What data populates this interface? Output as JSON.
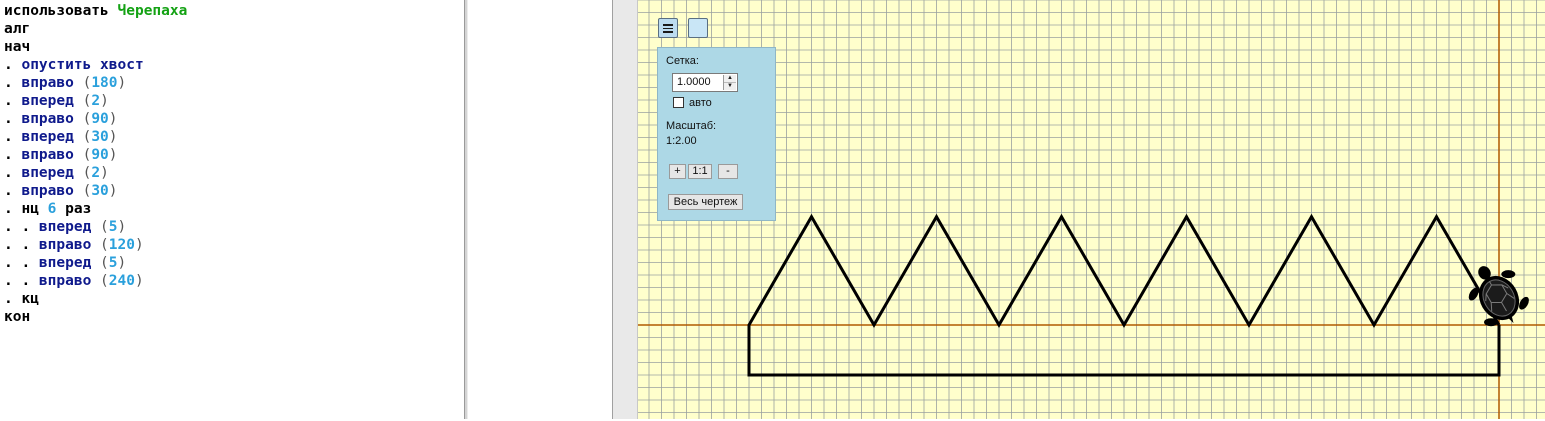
{
  "editor": {
    "lines": [
      [
        {
          "t": "использовать ",
          "c": "kw"
        },
        {
          "t": "Черепаха",
          "c": "actor"
        }
      ],
      [
        {
          "t": "алг",
          "c": "kw"
        }
      ],
      [
        {
          "t": "нач",
          "c": "kw"
        }
      ],
      [
        {
          "t": ". ",
          "c": "dot"
        },
        {
          "t": "опустить хвост",
          "c": "cmd"
        }
      ],
      [
        {
          "t": ". ",
          "c": "dot"
        },
        {
          "t": "вправо",
          "c": "cmd"
        },
        {
          "t": " (",
          "c": "paren"
        },
        {
          "t": "180",
          "c": "num"
        },
        {
          "t": ")",
          "c": "paren"
        }
      ],
      [
        {
          "t": ". ",
          "c": "dot"
        },
        {
          "t": "вперед",
          "c": "cmd"
        },
        {
          "t": " (",
          "c": "paren"
        },
        {
          "t": "2",
          "c": "num"
        },
        {
          "t": ")",
          "c": "paren"
        }
      ],
      [
        {
          "t": ". ",
          "c": "dot"
        },
        {
          "t": "вправо",
          "c": "cmd"
        },
        {
          "t": " (",
          "c": "paren"
        },
        {
          "t": "90",
          "c": "num"
        },
        {
          "t": ")",
          "c": "paren"
        }
      ],
      [
        {
          "t": ". ",
          "c": "dot"
        },
        {
          "t": "вперед",
          "c": "cmd"
        },
        {
          "t": " (",
          "c": "paren"
        },
        {
          "t": "30",
          "c": "num"
        },
        {
          "t": ")",
          "c": "paren"
        }
      ],
      [
        {
          "t": ". ",
          "c": "dot"
        },
        {
          "t": "вправо",
          "c": "cmd"
        },
        {
          "t": " (",
          "c": "paren"
        },
        {
          "t": "90",
          "c": "num"
        },
        {
          "t": ")",
          "c": "paren"
        }
      ],
      [
        {
          "t": ". ",
          "c": "dot"
        },
        {
          "t": "вперед",
          "c": "cmd"
        },
        {
          "t": " (",
          "c": "paren"
        },
        {
          "t": "2",
          "c": "num"
        },
        {
          "t": ")",
          "c": "paren"
        }
      ],
      [
        {
          "t": ". ",
          "c": "dot"
        },
        {
          "t": "вправо",
          "c": "cmd"
        },
        {
          "t": " (",
          "c": "paren"
        },
        {
          "t": "30",
          "c": "num"
        },
        {
          "t": ")",
          "c": "paren"
        }
      ],
      [
        {
          "t": ". ",
          "c": "dot"
        },
        {
          "t": "нц ",
          "c": "kw"
        },
        {
          "t": "6",
          "c": "num"
        },
        {
          "t": " раз",
          "c": "kw"
        }
      ],
      [
        {
          "t": ". . ",
          "c": "dot"
        },
        {
          "t": "вперед",
          "c": "cmd"
        },
        {
          "t": " (",
          "c": "paren"
        },
        {
          "t": "5",
          "c": "num"
        },
        {
          "t": ")",
          "c": "paren"
        }
      ],
      [
        {
          "t": ". . ",
          "c": "dot"
        },
        {
          "t": "вправо",
          "c": "cmd"
        },
        {
          "t": " (",
          "c": "paren"
        },
        {
          "t": "120",
          "c": "num"
        },
        {
          "t": ")",
          "c": "paren"
        }
      ],
      [
        {
          "t": ". . ",
          "c": "dot"
        },
        {
          "t": "вперед",
          "c": "cmd"
        },
        {
          "t": " (",
          "c": "paren"
        },
        {
          "t": "5",
          "c": "num"
        },
        {
          "t": ")",
          "c": "paren"
        }
      ],
      [
        {
          "t": ". . ",
          "c": "dot"
        },
        {
          "t": "вправо",
          "c": "cmd"
        },
        {
          "t": " (",
          "c": "paren"
        },
        {
          "t": "240",
          "c": "num"
        },
        {
          "t": ")",
          "c": "paren"
        }
      ],
      [
        {
          "t": ". ",
          "c": "dot"
        },
        {
          "t": "кц",
          "c": "kw"
        }
      ],
      [
        {
          "t": "кон",
          "c": "kw"
        }
      ]
    ]
  },
  "settings_panel": {
    "grid_label": "Сетка:",
    "grid_value": "1.0000",
    "auto_label": "авто",
    "auto_checked": false,
    "scale_label": "Масштаб:",
    "scale_value": "1:2.00",
    "zoom_in_label": "+",
    "zoom_reset_label": "1:1",
    "zoom_out_label": "-",
    "whole_drawing_label": "Весь чертеж"
  },
  "toolbar": {
    "menu_icon": "hamburger-icon",
    "panel_icon": "square-icon"
  },
  "colors": {
    "canvas_background": "#ffffcc",
    "grid_line": "#9aa0a0",
    "axis_line": "#b05a00",
    "drawing_line": "#000000",
    "panel_background": "#add8e6"
  }
}
